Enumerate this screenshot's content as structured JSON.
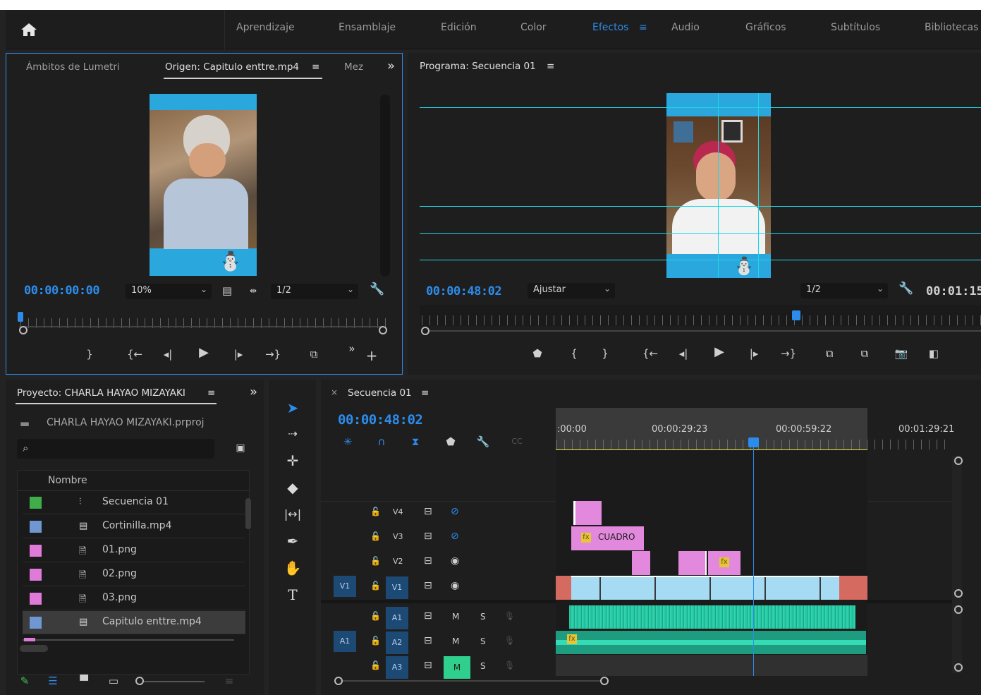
{
  "header": {
    "workspaces": [
      "Aprendizaje",
      "Ensamblaje",
      "Edición",
      "Color",
      "Efectos",
      "Audio",
      "Gráficos",
      "Subtítulos",
      "Bibliotecas"
    ],
    "active_workspace": "Efectos",
    "menu_glyph": "≡"
  },
  "source_panel": {
    "tabs": [
      "Ámbitos de Lumetri",
      "Origen: Capitulo enttre.mp4",
      "Mez"
    ],
    "menu_glyph": "≡",
    "overflow_glyph": "»",
    "timecode": "00:00:00:00",
    "zoom": "10%",
    "resolution": "1/2"
  },
  "program_panel": {
    "title": "Programa: Secuencia 01",
    "menu_glyph": "≡",
    "timecode": "00:00:48:02",
    "zoom": "Ajustar",
    "resolution": "1/2",
    "duration": "00:01:15"
  },
  "project_panel": {
    "title": "Proyecto: CHARLA HAYAO MIZAYAKI",
    "menu_glyph": "≡",
    "overflow_glyph": "»",
    "file": "CHARLA HAYAO MIZAYAKI.prproj",
    "column_name": "Nombre",
    "items": [
      {
        "name": "Secuencia 01",
        "color": "#3fae4a",
        "icon": "sequence-icon"
      },
      {
        "name": "Cortinilla.mp4",
        "color": "#6f98d2",
        "icon": "video-file-icon"
      },
      {
        "name": "01.png",
        "color": "#e07ad9",
        "icon": "image-file-icon"
      },
      {
        "name": "02.png",
        "color": "#e07ad9",
        "icon": "image-file-icon"
      },
      {
        "name": "03.png",
        "color": "#e07ad9",
        "icon": "image-file-icon"
      },
      {
        "name": "Capitulo enttre.mp4",
        "color": "#6f98d2",
        "icon": "video-file-icon"
      }
    ]
  },
  "timeline": {
    "tab_close": "×",
    "title": "Secuencia 01",
    "menu_glyph": "≡",
    "timecode": "00:00:48:02",
    "ruler_labels": [
      ":00:00",
      "00:00:29:23",
      "00:00:59:22",
      "00:01:29:21"
    ],
    "video_tracks": [
      "V4",
      "V3",
      "V2",
      "V1"
    ],
    "audio_tracks": [
      "A1",
      "A2",
      "A3"
    ],
    "source_v": "V1",
    "source_a": "A1",
    "mute_label": "M",
    "solo_label": "S",
    "clip_label": "CUADRO",
    "fx_label": "fx"
  }
}
